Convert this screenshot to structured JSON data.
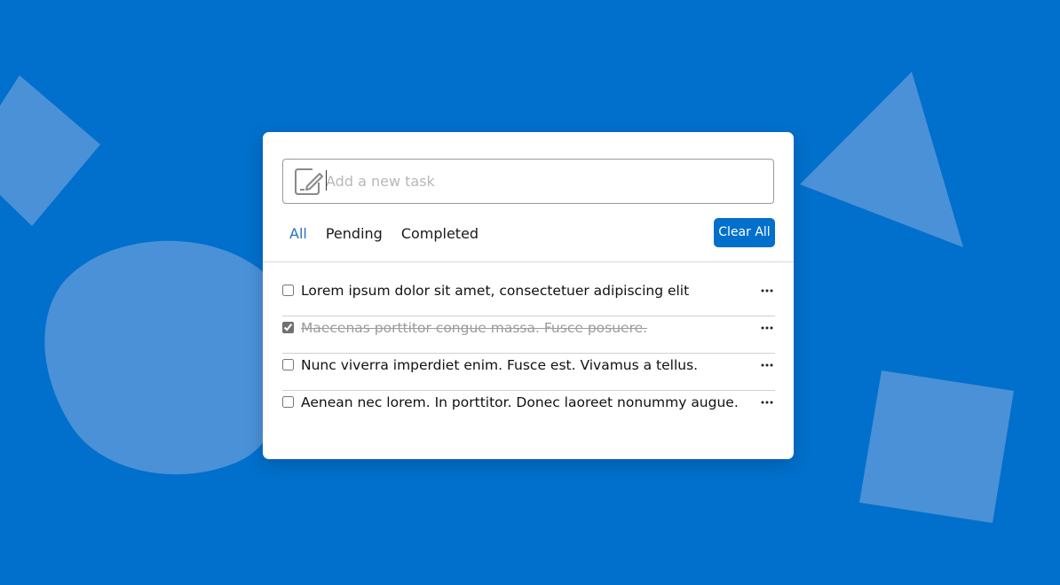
{
  "colors": {
    "background": "#0070CC",
    "shape": "#4A91D7",
    "accent": "#0070CC",
    "active_tab": "#2A72C6"
  },
  "input": {
    "placeholder": "Add a new task",
    "value": "",
    "icon": "edit-note-icon"
  },
  "filters": [
    {
      "label": "All",
      "active": true
    },
    {
      "label": "Pending",
      "active": false
    },
    {
      "label": "Completed",
      "active": false
    }
  ],
  "clear_button": {
    "label": "Clear All"
  },
  "tasks": [
    {
      "text": "Lorem ipsum dolor sit amet, consectetuer adipiscing elit",
      "completed": false
    },
    {
      "text": "Maecenas porttitor congue massa. Fusce posuere.",
      "completed": true
    },
    {
      "text": "Nunc viverra imperdiet enim. Fusce est. Vivamus a tellus.",
      "completed": false
    },
    {
      "text": "Aenean nec lorem. In porttitor. Donec laoreet nonummy augue.",
      "completed": false
    }
  ],
  "task_menu_icon": "more-horizontal-icon"
}
